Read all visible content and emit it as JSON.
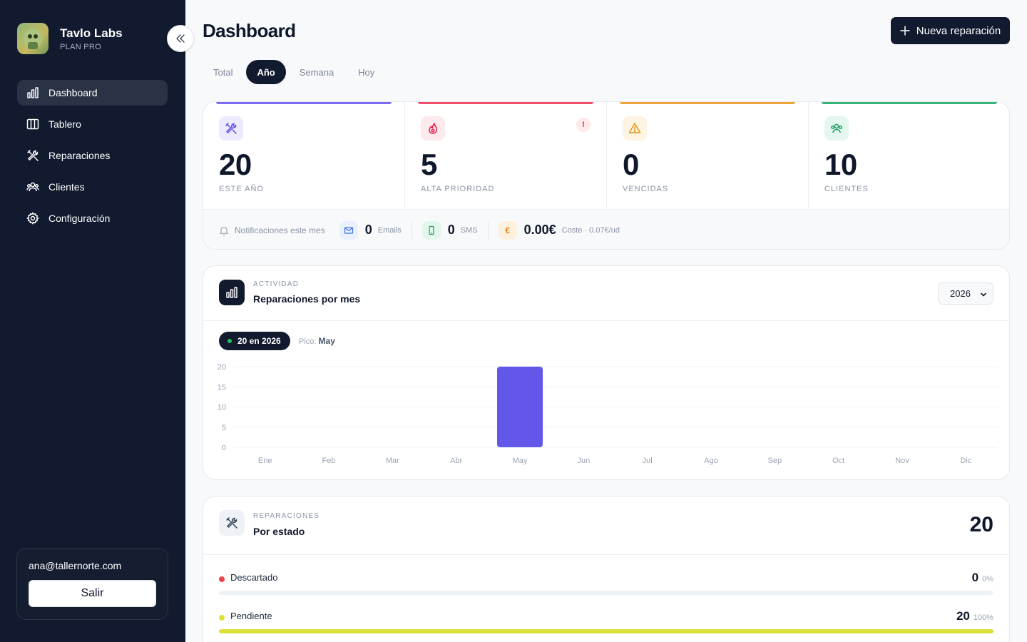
{
  "brand": {
    "name": "Tavlo Labs",
    "plan": "PLAN PRO"
  },
  "nav": [
    {
      "label": "Dashboard",
      "icon": "bar-chart-icon",
      "active": true
    },
    {
      "label": "Tablero",
      "icon": "columns-icon"
    },
    {
      "label": "Reparaciones",
      "icon": "tools-icon"
    },
    {
      "label": "Clientes",
      "icon": "users-icon"
    },
    {
      "label": "Configuración",
      "icon": "gear-icon"
    }
  ],
  "user": {
    "email": "ana@tallernorte.com",
    "logout_label": "Salir"
  },
  "header": {
    "title": "Dashboard",
    "new_button": "Nueva reparación"
  },
  "tabs": [
    {
      "label": "Total"
    },
    {
      "label": "Año",
      "active": true
    },
    {
      "label": "Semana"
    },
    {
      "label": "Hoy"
    }
  ],
  "stats": [
    {
      "value": "20",
      "label": "ESTE AÑO",
      "icon": "tools-icon",
      "color": "#6d5df5"
    },
    {
      "value": "5",
      "label": "ALTA PRIORIDAD",
      "icon": "flame-icon",
      "color": "#ef4f6a",
      "alert": "!"
    },
    {
      "value": "0",
      "label": "VENCIDAS",
      "icon": "warning-icon",
      "color": "#f0a23b"
    },
    {
      "value": "10",
      "label": "CLIENTES",
      "icon": "users-icon",
      "color": "#34b37b"
    }
  ],
  "notifications": {
    "label": "Notificaciones este mes",
    "emails_value": "0",
    "emails_label": "Emails",
    "sms_value": "0",
    "sms_label": "SMS",
    "cost_value": "0.00€",
    "cost_label": "Coste · 0.07€/ud",
    "cost_symbol": "€"
  },
  "activity": {
    "kicker": "ACTIVIDAD",
    "title": "Reparaciones por mes",
    "year_selected": "2026",
    "pill": "20 en 2026",
    "peak_label": "Pico:",
    "peak_value": "May"
  },
  "chart_data": {
    "type": "bar",
    "categories": [
      "Ene",
      "Feb",
      "Mar",
      "Abr",
      "May",
      "Jun",
      "Jul",
      "Ago",
      "Sep",
      "Oct",
      "Nov",
      "Dic"
    ],
    "values": [
      0,
      0,
      0,
      0,
      20,
      0,
      0,
      0,
      0,
      0,
      0,
      0
    ],
    "yticks": [
      0,
      5,
      10,
      15,
      20
    ],
    "ylim": [
      0,
      20
    ],
    "bar_color": "#6257e8",
    "grid": true
  },
  "status": {
    "kicker": "REPARACIONES",
    "title": "Por estado",
    "total": "20",
    "rows": [
      {
        "label": "Descartado",
        "count": "0",
        "pct": "0%",
        "fraction": 0,
        "color": "#ef4444"
      },
      {
        "label": "Pendiente",
        "count": "20",
        "pct": "100%",
        "fraction": 1,
        "color": "#dde03a"
      }
    ]
  }
}
